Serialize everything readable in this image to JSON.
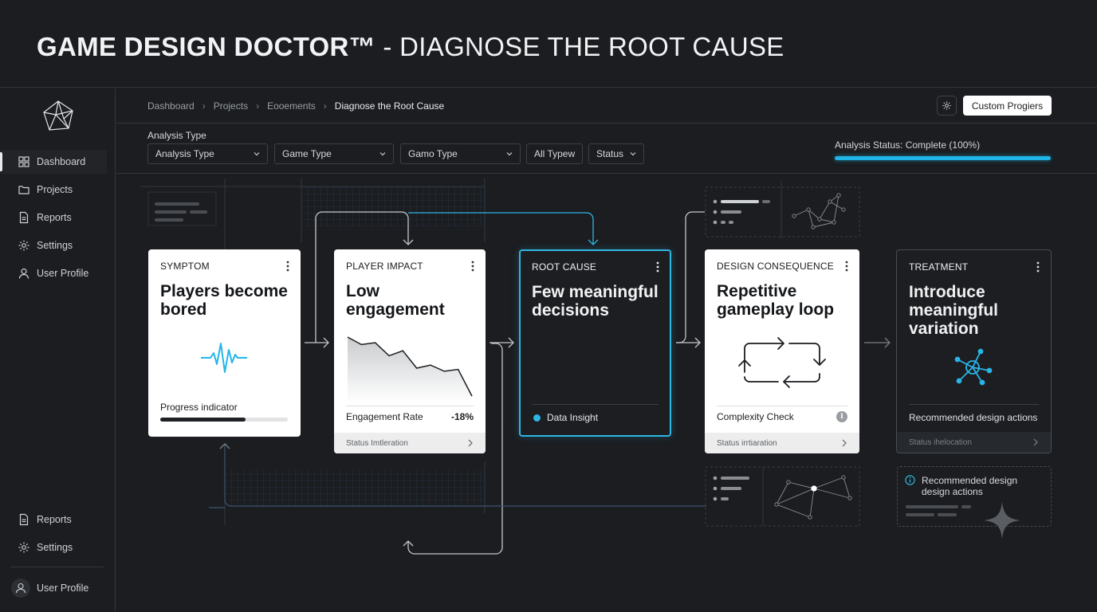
{
  "window": {
    "title_bold": "GAME DESIGN DOCTOR™",
    "title_rest": " - DIAGNOSE THE ROOT CAUSE"
  },
  "sidebar": {
    "logo_icon": "geodesic-logo-icon",
    "items": [
      {
        "label": "Dashboard",
        "icon": "grid-icon",
        "active": true
      },
      {
        "label": "Projects",
        "icon": "folder-icon"
      },
      {
        "label": "Reports",
        "icon": "document-icon"
      },
      {
        "label": "Settings",
        "icon": "gear-icon"
      },
      {
        "label": "User Profile",
        "icon": "user-icon"
      }
    ],
    "bottom_items": [
      {
        "label": "Reports",
        "icon": "document-icon"
      },
      {
        "label": "Settings",
        "icon": "gear-icon"
      },
      {
        "label": "User Profile",
        "icon": "avatar-icon"
      }
    ]
  },
  "breadcrumb": [
    "Dashboard",
    "Projects",
    "Eooements",
    "Diagnose the Root Cause"
  ],
  "header_actions": {
    "custom_button": "Custom Progiers"
  },
  "filters": {
    "label": "Analysis Type",
    "selects": [
      "Analysis Type",
      "Game Type",
      "Gamo Type",
      "All Typew",
      "Status"
    ]
  },
  "analysis_status": {
    "text": "Analysis Status: Complete (100%)",
    "percent": 100
  },
  "colors": {
    "accent": "#1fb3e6",
    "background": "#1b1d20",
    "card": "#ffffff"
  },
  "cards": {
    "symptom": {
      "header": "SYMPTOM",
      "title": "Players become bored",
      "progress_label": "Progress indicator",
      "progress": 0.67,
      "icon": "heartbeat-icon"
    },
    "impact": {
      "header": "PLAYER IMPACT",
      "title": "Low engagement",
      "metric_label": "Engagement Rate",
      "metric_value": "-18%",
      "footer": "Status Imtleration",
      "chart": [
        0.0,
        0.12,
        0.09,
        0.3,
        0.22,
        0.5,
        0.45,
        0.55,
        0.52,
        0.95
      ]
    },
    "root": {
      "header": "ROOT CAUSE",
      "title": "Few meaningful decisions",
      "insight": "Data Insight"
    },
    "consequence": {
      "header": "DESIGN CONSEQUENCE",
      "title": "Repetitive gameplay loop",
      "metric_label": "Complexity Check",
      "footer": "Status irrtiaration",
      "icon": "loop-arrows-icon"
    },
    "treatment": {
      "header": "TREATMENT",
      "title": "Introduce meaningful variation",
      "actions": "Recommended design actions",
      "footer": "Status ihelocation",
      "icon": "network-hub-icon"
    }
  },
  "recommendation": {
    "text": "Recommended design design actions"
  }
}
